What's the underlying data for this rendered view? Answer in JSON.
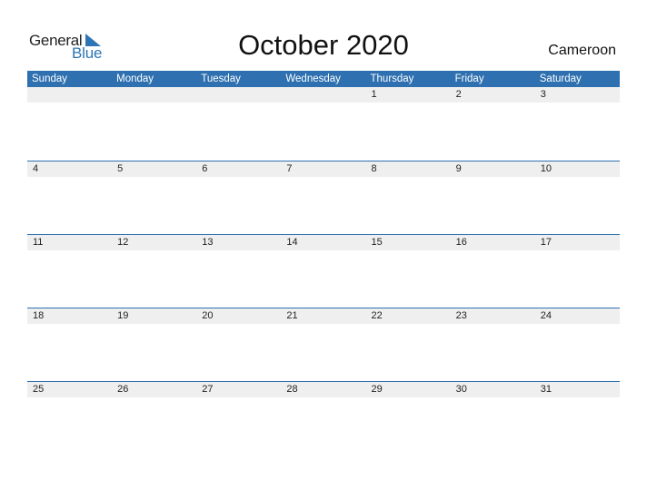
{
  "logo": {
    "word1": "General",
    "word2": "Blue"
  },
  "title": "October 2020",
  "country": "Cameroon",
  "colors": {
    "accent": "#2e70b0",
    "day_bar": "#efefef"
  },
  "weekdays": [
    "Sunday",
    "Monday",
    "Tuesday",
    "Wednesday",
    "Thursday",
    "Friday",
    "Saturday"
  ],
  "weeks": [
    [
      "",
      "",
      "",
      "",
      "1",
      "2",
      "3"
    ],
    [
      "4",
      "5",
      "6",
      "7",
      "8",
      "9",
      "10"
    ],
    [
      "11",
      "12",
      "13",
      "14",
      "15",
      "16",
      "17"
    ],
    [
      "18",
      "19",
      "20",
      "21",
      "22",
      "23",
      "24"
    ],
    [
      "25",
      "26",
      "27",
      "28",
      "29",
      "30",
      "31"
    ]
  ]
}
